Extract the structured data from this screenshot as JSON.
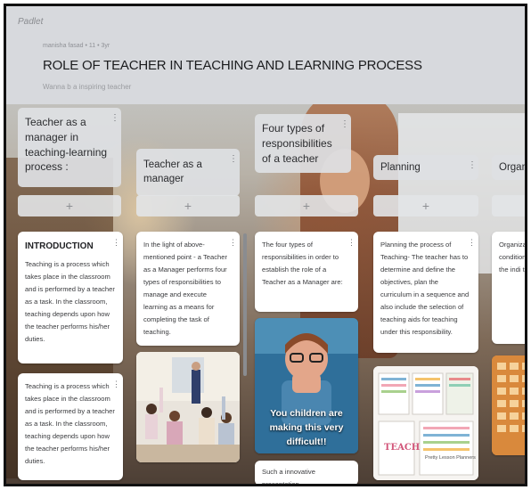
{
  "app": {
    "logo": "Padlet"
  },
  "board": {
    "meta": "manisha fasad • 11 • 3yr",
    "title": "ROLE OF TEACHER IN TEACHING AND LEARNING PROCESS",
    "subtitle": "Wanna b a inspiring teacher"
  },
  "columns": [
    {
      "title": "Teacher as a manager in teaching-learning process :"
    },
    {
      "title": "Teacher as a manager"
    },
    {
      "title": "Four types of responsibilities of a teacher"
    },
    {
      "title": "Planning"
    },
    {
      "title": "Organiza"
    }
  ],
  "add_label": "+",
  "menu_glyph": "⋮",
  "cards": {
    "intro_heading": "INTRODUCTION",
    "intro_body": "Teaching is a process which takes place in the classroom and is performed by a teacher as a task. In the classroom, teaching depends upon how the teacher performs his/her duties.",
    "intro_repeat": "Teaching is a process which takes place in the classroom and is performed by a teacher as a task. In the classroom, teaching depends upon how the teacher performs his/her duties.",
    "manager_body": "In the light of above-mentioned point - a Teacher as a Manager performs four types of responsibilities to manage and execute learning as a means for completing the task of teaching.",
    "four_types_body": "The four types of responsibilities in order to establish the role of a Teacher as a Manager are:",
    "meme_caption": "You children are making this very difficult!!",
    "innovative": "Such a innovative presentation",
    "planning_body": "Planning the process of Teaching- The teacher has to determine and define the objectives, plan the curriculum in a sequence and also include the selection of teaching aids for teaching under this responsibility.",
    "organizing_body": "Organization phase, teach conditions an to achieve ob view the indi the students."
  },
  "poster": {
    "text": "TEACH",
    "small": "Pretty Lesson Planners"
  }
}
